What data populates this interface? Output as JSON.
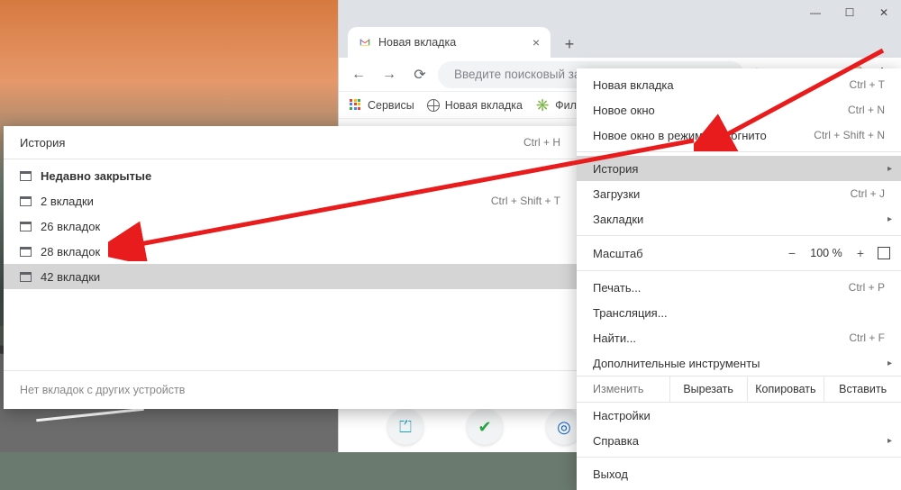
{
  "tab": {
    "title": "Новая вкладка"
  },
  "omnibox": {
    "placeholder": "Введите поисковый запрос в Google или укажите U..."
  },
  "bookmarks_bar": {
    "apps": "Сервисы",
    "newtab": "Новая вкладка",
    "films": "Фильм..."
  },
  "main_menu": {
    "new_tab": {
      "label": "Новая вкладка",
      "shortcut": "Ctrl + T"
    },
    "new_window": {
      "label": "Новое окно",
      "shortcut": "Ctrl + N"
    },
    "incognito": {
      "label": "Новое окно в режиме инкогнито",
      "shortcut": "Ctrl + Shift + N"
    },
    "history": {
      "label": "История"
    },
    "downloads": {
      "label": "Загрузки",
      "shortcut": "Ctrl + J"
    },
    "bookmarks": {
      "label": "Закладки"
    },
    "zoom": {
      "label": "Масштаб",
      "value": "100 %"
    },
    "print": {
      "label": "Печать...",
      "shortcut": "Ctrl + P"
    },
    "cast": {
      "label": "Трансляция..."
    },
    "find": {
      "label": "Найти...",
      "shortcut": "Ctrl + F"
    },
    "more_tools": {
      "label": "Дополнительные инструменты"
    },
    "edit": {
      "label": "Изменить",
      "cut": "Вырезать",
      "copy": "Копировать",
      "paste": "Вставить"
    },
    "settings": {
      "label": "Настройки"
    },
    "help": {
      "label": "Справка"
    },
    "exit": {
      "label": "Выход"
    }
  },
  "history_menu": {
    "title": {
      "label": "История",
      "shortcut": "Ctrl + H"
    },
    "recently_closed": "Недавно закрытые",
    "items": [
      {
        "label": "2 вкладки",
        "shortcut": "Ctrl + Shift + T"
      },
      {
        "label": "26 вкладок",
        "shortcut": ""
      },
      {
        "label": "28 вкладок",
        "shortcut": ""
      },
      {
        "label": "42 вкладки",
        "shortcut": ""
      }
    ],
    "footer": "Нет вкладок с других устройств"
  }
}
